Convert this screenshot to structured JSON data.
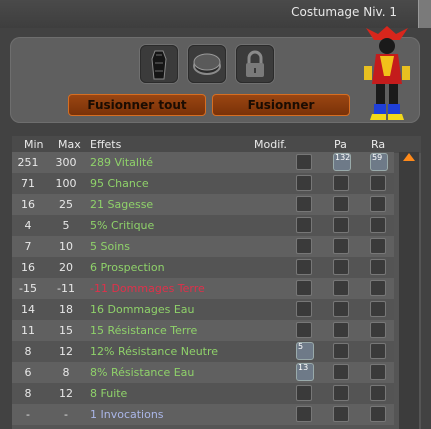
{
  "window": {
    "title": "Costumage Niv. 1"
  },
  "buttons": {
    "merge_all": "Fusionner tout",
    "merge": "Fusionner"
  },
  "columns": {
    "min": "Min",
    "max": "Max",
    "effects": "Effets",
    "modif": "Modif.",
    "pa": "Pa",
    "ra": "Ra"
  },
  "colors": {
    "positive": "#8fd26a",
    "negative": "#e0304a",
    "neutral": "#aab6e8",
    "accent": "#ff8a1a"
  },
  "rows": [
    {
      "min": "251",
      "max": "300",
      "effect": "289 Vitalité",
      "tone": "positive",
      "pa_badge": "132",
      "ra_badge": "59"
    },
    {
      "min": "71",
      "max": "100",
      "effect": "95 Chance",
      "tone": "positive"
    },
    {
      "min": "16",
      "max": "25",
      "effect": "21 Sagesse",
      "tone": "positive"
    },
    {
      "min": "4",
      "max": "5",
      "effect": "5% Critique",
      "tone": "positive"
    },
    {
      "min": "7",
      "max": "10",
      "effect": "5 Soins",
      "tone": "positive"
    },
    {
      "min": "16",
      "max": "20",
      "effect": "6 Prospection",
      "tone": "positive"
    },
    {
      "min": "-15",
      "max": "-11",
      "effect": "-11 Dommages Terre",
      "tone": "negative"
    },
    {
      "min": "14",
      "max": "18",
      "effect": "16 Dommages Eau",
      "tone": "positive"
    },
    {
      "min": "11",
      "max": "15",
      "effect": "15 Résistance Terre",
      "tone": "positive"
    },
    {
      "min": "8",
      "max": "12",
      "effect": "12% Résistance Neutre",
      "tone": "positive",
      "modif_badge": "5"
    },
    {
      "min": "6",
      "max": "8",
      "effect": "8% Résistance Eau",
      "tone": "positive",
      "modif_badge": "13"
    },
    {
      "min": "8",
      "max": "12",
      "effect": "8 Fuite",
      "tone": "positive"
    },
    {
      "min": "-",
      "max": "-",
      "effect": "1 Invocations",
      "tone": "neutral"
    }
  ]
}
